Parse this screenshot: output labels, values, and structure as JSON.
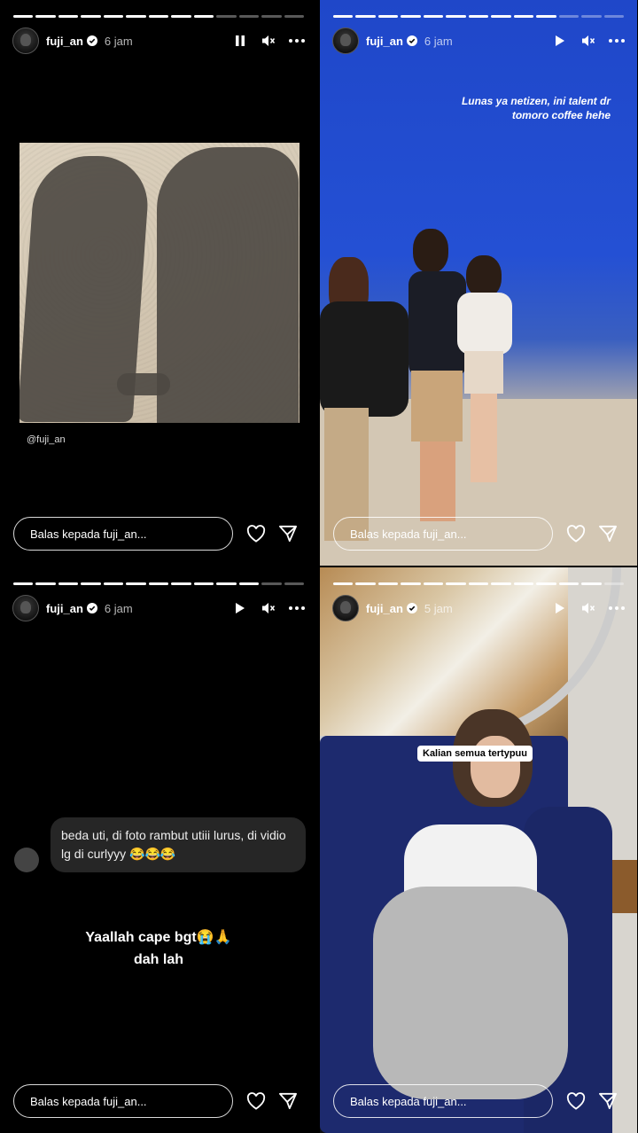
{
  "panels": [
    {
      "username": "fuji_an",
      "time": "6 jam",
      "progress_segments": 13,
      "progress_done": 9,
      "play_state": "pause",
      "mention": "@fuji_an",
      "reply_placeholder": "Balas kepada fuji_an..."
    },
    {
      "username": "fuji_an",
      "time": "6 jam",
      "progress_segments": 13,
      "progress_done": 10,
      "play_state": "play",
      "caption": "Lunas ya netizen, ini talent dr tomoro coffee hehe",
      "reply_placeholder": "Balas kepada fuji_an..."
    },
    {
      "username": "fuji_an",
      "time": "6 jam",
      "progress_segments": 13,
      "progress_done": 11,
      "play_state": "play",
      "comment": "beda uti, di foto rambut utiii lurus, di vidio lg di curlyyy 😂😂😂",
      "big_text_line1": "Yaallah cape bgt😭🙏",
      "big_text_line2": "dah lah",
      "reply_placeholder": "Balas kepada fuji_an..."
    },
    {
      "username": "fuji_an",
      "time": "5 jam",
      "progress_segments": 13,
      "progress_done": 12,
      "play_state": "play",
      "tag": "Kalian semua tertypuu",
      "reply_placeholder": "Balas kepada fuji_an..."
    }
  ],
  "icons": {
    "verified": "verified-badge-icon",
    "pause": "pause-icon",
    "play": "play-icon",
    "mute": "mute-icon",
    "more": "more-icon",
    "like": "heart-icon",
    "send": "send-icon"
  },
  "colors": {
    "verified": "#3897f0",
    "reply_border": "#ffffff",
    "bubble": "#262626"
  }
}
